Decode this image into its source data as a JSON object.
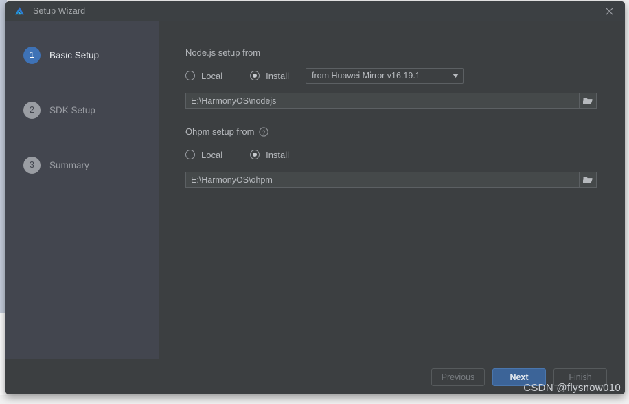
{
  "window": {
    "title": "Setup Wizard",
    "logo_icon": "deveco-triangle-logo-icon",
    "close_icon": "close-icon"
  },
  "sidebar": {
    "steps": [
      {
        "number": "1",
        "label": "Basic Setup",
        "state": "active"
      },
      {
        "number": "2",
        "label": "SDK Setup",
        "state": "inactive"
      },
      {
        "number": "3",
        "label": "Summary",
        "state": "inactive"
      }
    ]
  },
  "content": {
    "nodejs": {
      "group_title": "Node.js setup from",
      "local_label": "Local",
      "install_label": "Install",
      "selected": "Install",
      "mirror_value": "from Huawei Mirror v16.19.1",
      "mirror_arrow_icon": "chevron-down-icon",
      "path_value": "E:\\HarmonyOS\\nodejs",
      "browse_icon": "folder-icon"
    },
    "ohpm": {
      "group_title": "Ohpm setup from",
      "help_icon": "question-circle-icon",
      "local_label": "Local",
      "install_label": "Install",
      "selected": "Install",
      "path_value": "E:\\HarmonyOS\\ohpm",
      "browse_icon": "folder-icon"
    }
  },
  "footer": {
    "previous_label": "Previous",
    "next_label": "Next",
    "finish_label": "Finish"
  },
  "watermark": {
    "text": "CSDN @flysnow010"
  },
  "colors": {
    "dialog_bg": "#3c3f41",
    "sidebar_bg": "#43464f",
    "titlebar_bg": "#3c4043",
    "accent_blue": "#3e72b6",
    "primary_button": "#3c6498",
    "text_primary": "#b6b9bd",
    "text_muted": "#9a9da3",
    "field_bg": "#45494a"
  }
}
